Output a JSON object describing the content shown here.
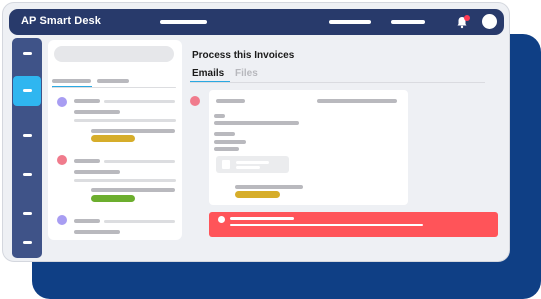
{
  "app": {
    "title": "AP Smart Desk"
  },
  "main": {
    "title": "Process this Invoices",
    "tabs": [
      {
        "label": "Emails",
        "active": true
      },
      {
        "label": "Files",
        "active": false
      }
    ]
  },
  "icons": {
    "bell": "bell-icon",
    "notification_dot": "notification-dot",
    "avatar": "user-avatar"
  },
  "colors": {
    "titlebar": "#283a6b",
    "sidebar": "#3f5388",
    "sidebar_active": "#2fb6f0",
    "backdrop": "#0f3f85",
    "tab_underline": "#2aa9e2",
    "alert": "#ff5459",
    "dot_purple": "#a89df2",
    "dot_pink": "#f07b8c",
    "badge_gold": "#d6ad2a",
    "badge_green": "#6cae2e"
  }
}
